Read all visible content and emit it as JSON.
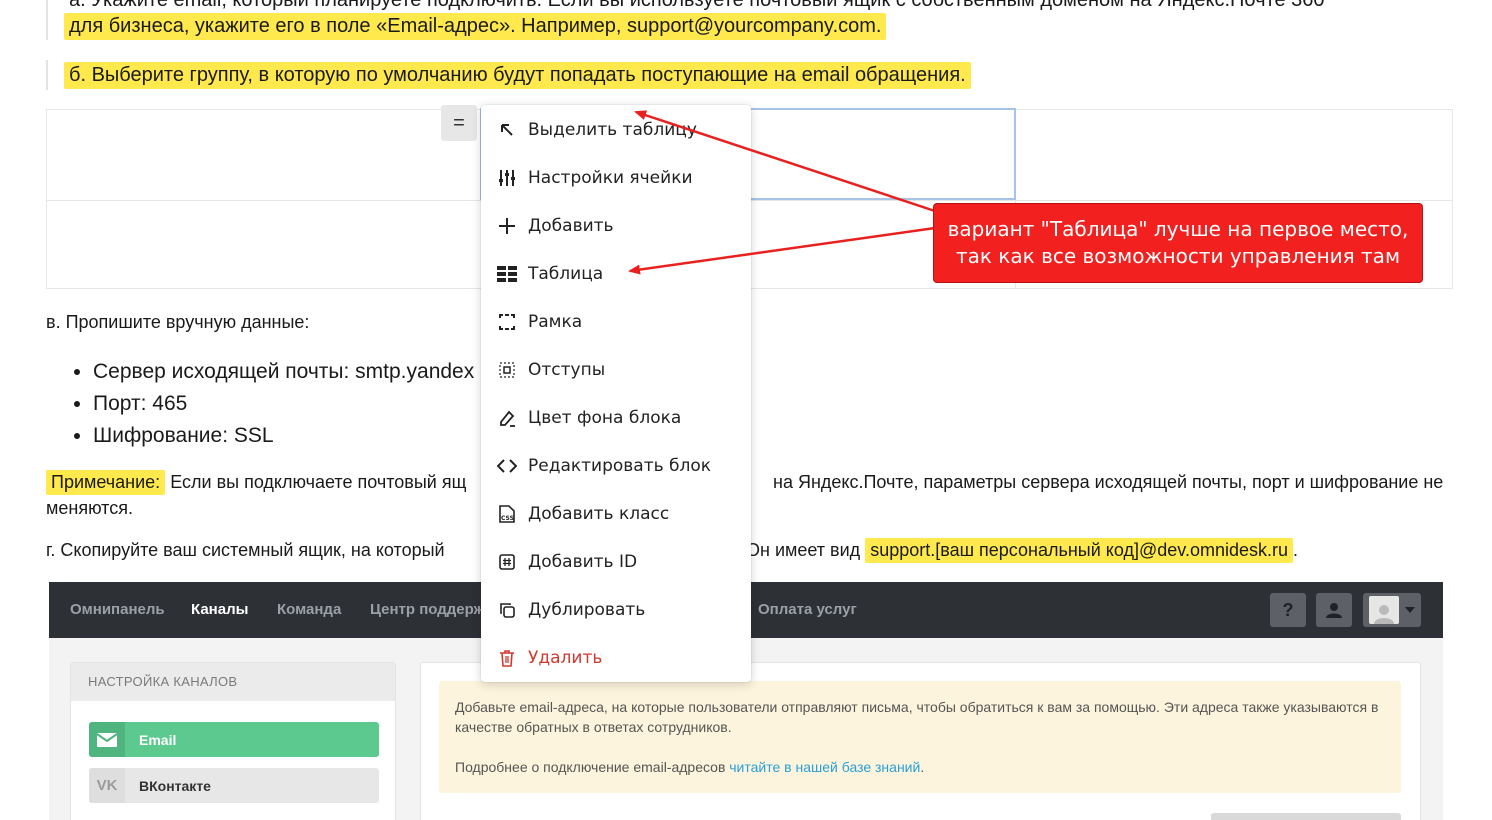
{
  "doc": {
    "line_a_partial": "а. Укажите email, который планируете подключить. Если вы используете почтовый ящик с собственным доменом на Яндекс.Почте 360",
    "line_a_hl": "для бизнеса, укажите его в поле «Email-адрес». Например, support@yourcompany.com.",
    "line_b_hl": "б. Выберите группу, в которую по умолчанию будут попадать поступающие на email обращения.",
    "line_v": "в. Пропишите вручную данные:",
    "bullets": [
      "Сервер исходящей почты: smtp.yandex",
      "Порт: 465",
      "Шифрование: SSL"
    ],
    "note_label": "Примечание:",
    "note_text_1": "Если вы подключаете почтовый ящ",
    "note_text_2": "на Яндекс.Почте, параметры сервера исходящей почты, порт и шифрование не",
    "note_line_2": "меняются.",
    "line_g_1": "г. Скопируйте ваш системный ящик, на который",
    "line_g_2": "Он имеет вид",
    "line_g_hl": "support.[ваш персональный код]@dev.omnidesk.ru",
    "line_g_end": ".",
    "table_handle": "="
  },
  "context_menu": {
    "items": [
      {
        "label": "Выделить таблицу",
        "icon": "arrow-up-left-icon"
      },
      {
        "label": "Настройки ячейки",
        "icon": "sliders-icon"
      },
      {
        "label": "Добавить",
        "icon": "plus-icon"
      },
      {
        "label": "Таблица",
        "icon": "table-icon"
      },
      {
        "label": "Рамка",
        "icon": "border-icon"
      },
      {
        "label": "Отступы",
        "icon": "padding-icon"
      },
      {
        "label": "Цвет фона блока",
        "icon": "paint-icon"
      },
      {
        "label": "Редактировать блок",
        "icon": "code-icon"
      },
      {
        "label": "Добавить класс",
        "icon": "css-file-icon"
      },
      {
        "label": "Добавить ID",
        "icon": "hash-icon"
      },
      {
        "label": "Дублировать",
        "icon": "duplicate-icon"
      },
      {
        "label": "Удалить",
        "icon": "trash-icon"
      }
    ]
  },
  "callout": {
    "line1": "вариант \"Таблица\" лучше на первое место,",
    "line2": "так как все возможности управления там",
    "color": "#f2211f"
  },
  "app": {
    "nav": [
      "Омнипанель",
      "Каналы",
      "Команда",
      "Центр поддерж",
      "Оплата услуг"
    ],
    "nav_active": "Каналы",
    "help_glyph": "?",
    "sidebar_title": "НАСТРОЙКА КАНАЛОВ",
    "sidebar_items": [
      {
        "label": "Email",
        "color": "#5cc98f"
      },
      {
        "label": "ВКонтакте",
        "color": "#e7e7e7"
      }
    ],
    "notice_p1": "Добавьте email-адреса, на которые пользователи отправляют письма, чтобы обратиться к вам за помощью. Эти адреса также указываются в качестве обратных в ответах сотрудников.",
    "notice_p2_text": "Подробнее о подключение email-адресов",
    "notice_p2_link": "читайте в нашей базе знаний",
    "notice_p2_end": "."
  }
}
